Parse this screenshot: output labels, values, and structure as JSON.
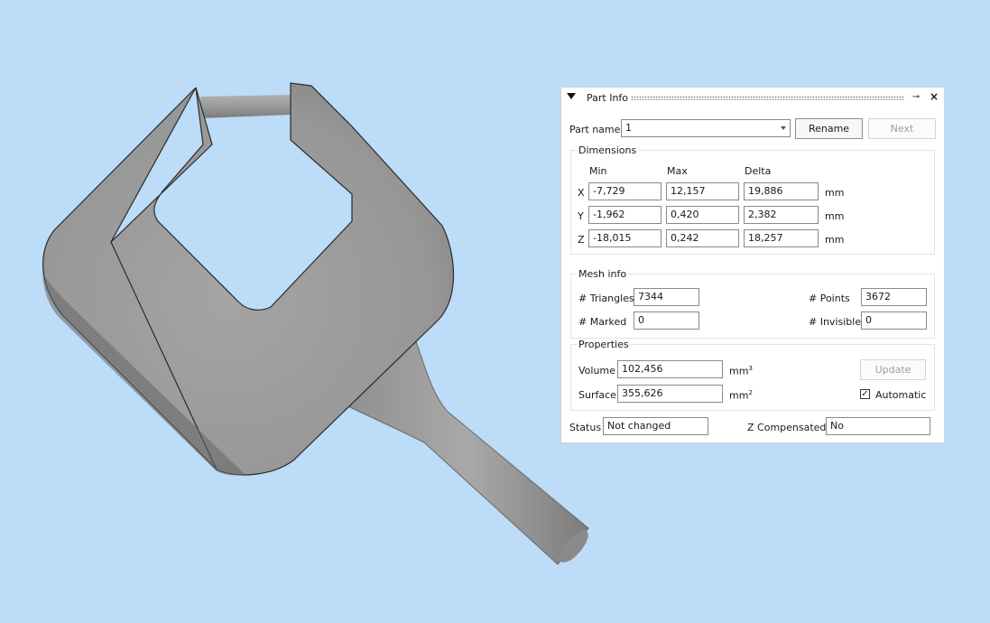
{
  "panel": {
    "title": "Part Info",
    "pin_icon": "pin-icon",
    "close_icon": "close-icon",
    "part_name_label": "Part name",
    "part_name_value": "1",
    "rename_label": "Rename",
    "next_label": "Next",
    "dimensions": {
      "title": "Dimensions",
      "headers": [
        "Min",
        "Max",
        "Delta"
      ],
      "rows": [
        {
          "axis": "X",
          "min": "-7,729",
          "max": "12,157",
          "delta": "19,886",
          "unit": "mm"
        },
        {
          "axis": "Y",
          "min": "-1,962",
          "max": "0,420",
          "delta": "2,382",
          "unit": "mm"
        },
        {
          "axis": "Z",
          "min": "-18,015",
          "max": "0,242",
          "delta": "18,257",
          "unit": "mm"
        }
      ]
    },
    "mesh": {
      "title": "Mesh info",
      "triangles_label": "# Triangles",
      "triangles_value": "7344",
      "points_label": "# Points",
      "points_value": "3672",
      "marked_label": "# Marked",
      "marked_value": "0",
      "invisible_label": "# Invisible",
      "invisible_value": "0"
    },
    "properties": {
      "title": "Properties",
      "volume_label": "Volume",
      "volume_value": "102,456",
      "volume_unit": "mm",
      "volume_exp": "3",
      "surface_label": "Surface",
      "surface_value": "355,626",
      "surface_unit": "mm",
      "surface_exp": "2",
      "update_label": "Update",
      "automatic_label": "Automatic",
      "automatic_checked": true
    },
    "status_label": "Status",
    "status_value": "Not changed",
    "zcomp_label": "Z Compensated",
    "zcomp_value": "No"
  },
  "colors": {
    "background": "#bcdcf7",
    "model": "#9b9b9b"
  }
}
